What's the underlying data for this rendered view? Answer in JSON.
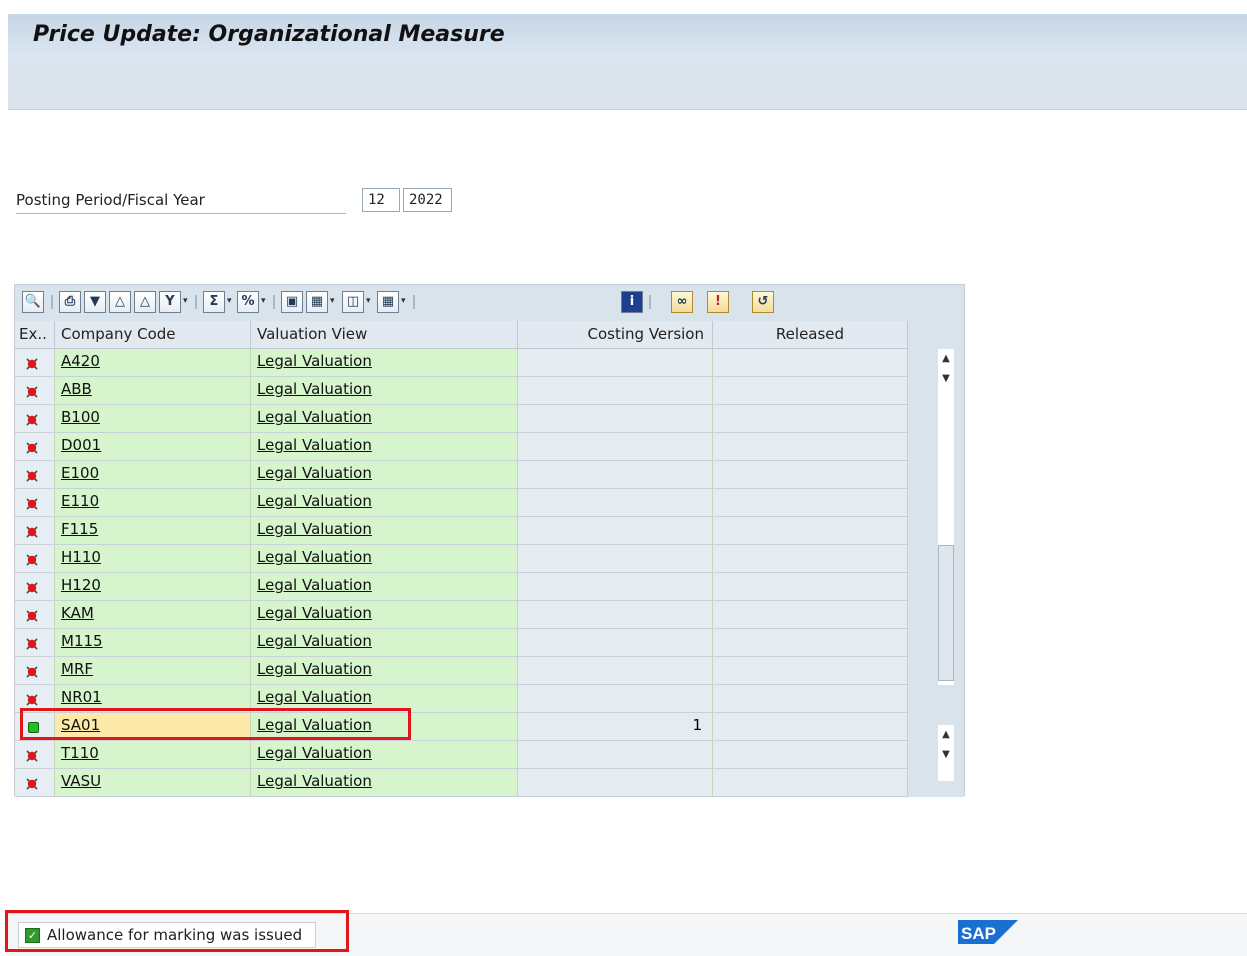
{
  "window": {
    "title": "Price Update: Organizational Measure"
  },
  "selection": {
    "period_label": "Posting Period/Fiscal Year",
    "period": "12",
    "year": "2022"
  },
  "grid": {
    "headers": {
      "ex": "Ex..",
      "company_code": "Company Code",
      "valuation_view": "Valuation View",
      "costing_version": "Costing Version",
      "released": "Released"
    },
    "rows": [
      {
        "status": "error",
        "company_code": "A420",
        "valuation_view": "Legal Valuation",
        "costing_version": "",
        "released": ""
      },
      {
        "status": "error",
        "company_code": "ABB",
        "valuation_view": "Legal Valuation",
        "costing_version": "",
        "released": ""
      },
      {
        "status": "error",
        "company_code": "B100",
        "valuation_view": "Legal Valuation",
        "costing_version": "",
        "released": ""
      },
      {
        "status": "error",
        "company_code": "D001",
        "valuation_view": "Legal Valuation",
        "costing_version": "",
        "released": ""
      },
      {
        "status": "error",
        "company_code": "E100",
        "valuation_view": "Legal Valuation",
        "costing_version": "",
        "released": ""
      },
      {
        "status": "error",
        "company_code": "E110",
        "valuation_view": "Legal Valuation",
        "costing_version": "",
        "released": ""
      },
      {
        "status": "error",
        "company_code": "F115",
        "valuation_view": "Legal Valuation",
        "costing_version": "",
        "released": ""
      },
      {
        "status": "error",
        "company_code": "H110",
        "valuation_view": "Legal Valuation",
        "costing_version": "",
        "released": ""
      },
      {
        "status": "error",
        "company_code": "H120",
        "valuation_view": "Legal Valuation",
        "costing_version": "",
        "released": ""
      },
      {
        "status": "error",
        "company_code": "KAM",
        "valuation_view": "Legal Valuation",
        "costing_version": "",
        "released": ""
      },
      {
        "status": "error",
        "company_code": "M115",
        "valuation_view": "Legal Valuation",
        "costing_version": "",
        "released": ""
      },
      {
        "status": "error",
        "company_code": "MRF",
        "valuation_view": "Legal Valuation",
        "costing_version": "",
        "released": ""
      },
      {
        "status": "error",
        "company_code": "NR01",
        "valuation_view": "Legal Valuation",
        "costing_version": "",
        "released": ""
      },
      {
        "status": "success",
        "company_code": "SA01",
        "valuation_view": "Legal Valuation",
        "costing_version": "1",
        "released": ""
      },
      {
        "status": "error",
        "company_code": "T110",
        "valuation_view": "Legal Valuation",
        "costing_version": "",
        "released": ""
      },
      {
        "status": "error",
        "company_code": "VASU",
        "valuation_view": "Legal Valuation",
        "costing_version": "",
        "released": ""
      }
    ],
    "selected_row": 13
  },
  "toolbar_icons": [
    "details-icon",
    "print-icon",
    "sort-icon",
    "find-icon",
    "find-next-icon",
    "filter-icon",
    "sum-icon",
    "subtotal-icon",
    "print-preview-icon",
    "export-icon",
    "spreadsheet-icon",
    "layout-icon",
    "info-icon",
    "graphic-icon",
    "abc-analysis-icon",
    "refresh-icon"
  ],
  "status_bar": {
    "message": "Allowance for marking was issued",
    "type": "success"
  },
  "branding": {
    "logo": "SAP"
  },
  "colors": {
    "title_bg": "#c6d6e6",
    "key_column_bg": "#d6f5cc",
    "data_column_bg": "#e4ebf1",
    "highlight": "#e0161a",
    "selected_cell": "#fde9a8",
    "status_success": "#2f9b2f"
  }
}
